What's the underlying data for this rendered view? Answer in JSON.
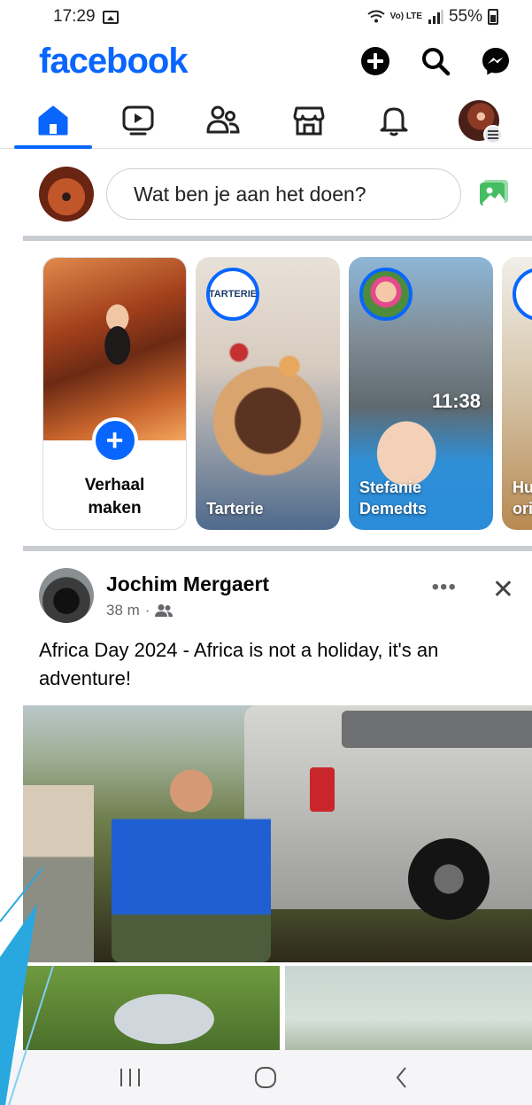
{
  "status_bar": {
    "time": "17:29",
    "network": "Vo) LTE",
    "battery": "55%"
  },
  "header": {
    "logo": "facebook",
    "actions": [
      "create-icon",
      "search-icon",
      "messenger-icon"
    ]
  },
  "tabs": [
    {
      "name": "home",
      "icon": "home-icon",
      "active": true
    },
    {
      "name": "video",
      "icon": "video-icon",
      "active": false
    },
    {
      "name": "friends",
      "icon": "friends-icon",
      "active": false
    },
    {
      "name": "marketplace",
      "icon": "marketplace-icon",
      "active": false
    },
    {
      "name": "notifications",
      "icon": "bell-icon",
      "active": false
    },
    {
      "name": "menu",
      "icon": "profile-avatar",
      "active": false
    }
  ],
  "composer": {
    "placeholder": "Wat ben je aan het doen?"
  },
  "stories": [
    {
      "type": "create",
      "label_line1": "Verhaal",
      "label_line2": "maken"
    },
    {
      "type": "story",
      "name_line1": "Tarterie",
      "name_line2": "",
      "ring_text": "TARTERIE"
    },
    {
      "type": "story",
      "name_line1": "Stefanie",
      "name_line2": "Demedts",
      "overlay_time": "11:38"
    },
    {
      "type": "story",
      "name_line1": "Hu",
      "name_line2": "ori"
    }
  ],
  "post": {
    "author": "Jochim Mergaert",
    "time": "38 m",
    "audience": "friends-icon",
    "more_label": "•••",
    "close_label": "✕",
    "text": "Africa Day 2024 - Africa is not a holiday, it's an adventure!"
  },
  "colors": {
    "brand": "#0866ff",
    "secondary_text": "#65676b",
    "divider": "#c9ccd1"
  }
}
